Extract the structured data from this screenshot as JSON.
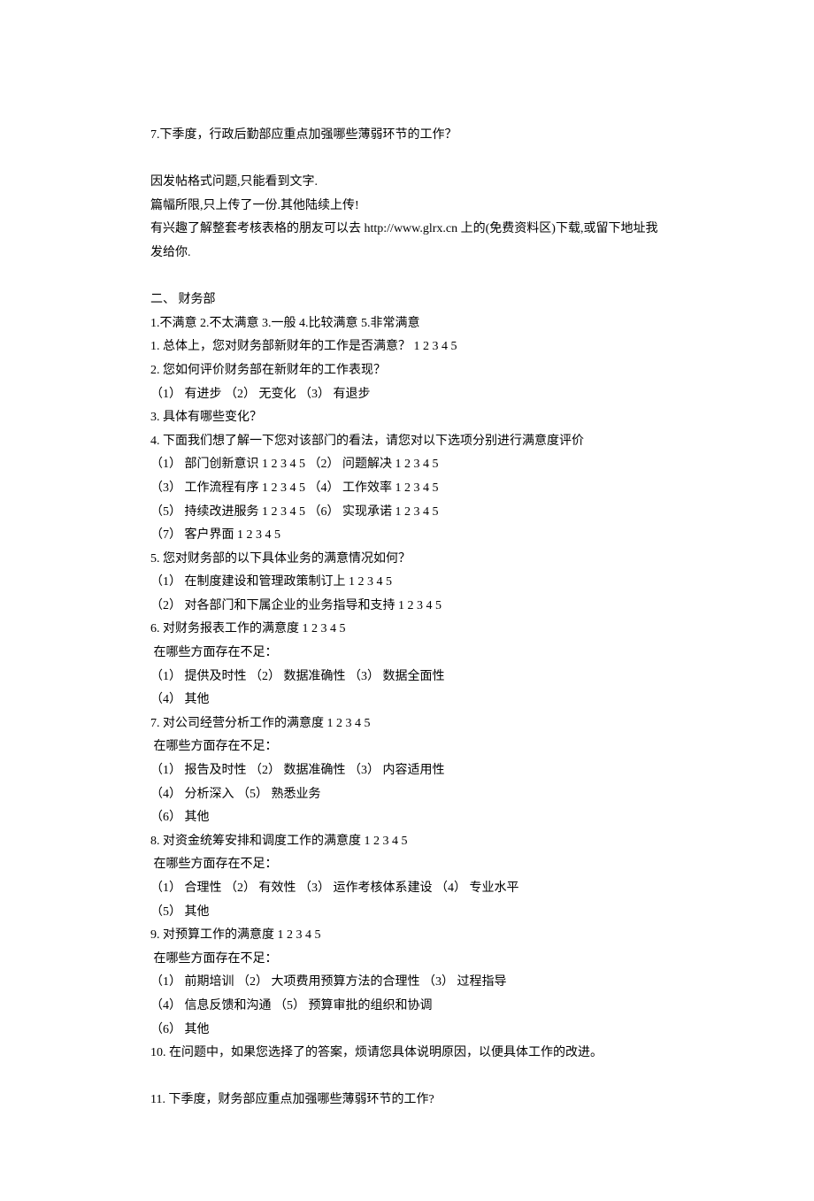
{
  "lines": [
    "7.下季度，行政后勤部应重点加强哪些薄弱环节的工作？",
    "",
    "因发帖格式问题,只能看到文字.",
    "篇幅所限,只上传了一份.其他陆续上传!",
    "有兴趣了解整套考核表格的朋友可以去 http://www.glrx.cn 上的(免费资料区)下载,或留下地址我发给你.",
    "",
    "二、 财务部",
    "1.不满意 2.不太满意 3.一般 4.比较满意 5.非常满意",
    "1. 总体上，您对财务部新财年的工作是否满意？ 1 2 3 4 5",
    "2. 您如何评价财务部在新财年的工作表现？",
    "（1） 有进步 （2） 无变化 （3） 有退步",
    "3. 具体有哪些变化？",
    "4. 下面我们想了解一下您对该部门的看法，请您对以下选项分别进行满意度评价",
    "（1） 部门创新意识 1 2 3 4 5 （2） 问题解决 1 2 3 4 5",
    "（3） 工作流程有序 1 2 3 4 5 （4） 工作效率 1 2 3 4 5",
    "（5） 持续改进服务 1 2 3 4 5 （6） 实现承诺 1 2 3 4 5",
    "（7） 客户界面 1 2 3 4 5",
    "5. 您对财务部的以下具体业务的满意情况如何？",
    "（1） 在制度建设和管理政策制订上 1 2 3 4 5",
    "（2） 对各部门和下属企业的业务指导和支持 1 2 3 4 5",
    "6. 对财务报表工作的满意度 1 2 3 4 5",
    " 在哪些方面存在不足：",
    "（1） 提供及时性 （2） 数据准确性 （3） 数据全面性",
    "（4） 其他",
    "7. 对公司经营分析工作的满意度 1 2 3 4 5",
    " 在哪些方面存在不足：",
    "（1） 报告及时性 （2） 数据准确性 （3） 内容适用性",
    "（4） 分析深入 （5） 熟悉业务",
    "（6） 其他",
    "8. 对资金统筹安排和调度工作的满意度 1 2 3 4 5",
    " 在哪些方面存在不足：",
    "（1） 合理性 （2） 有效性 （3） 运作考核体系建设 （4） 专业水平",
    "（5） 其他",
    "9. 对预算工作的满意度 1 2 3 4 5",
    " 在哪些方面存在不足：",
    "（1） 前期培训 （2） 大项费用预算方法的合理性 （3） 过程指导",
    "（4） 信息反馈和沟通 （5） 预算审批的组织和协调",
    "（6） 其他",
    "10. 在问题中，如果您选择了的答案，烦请您具体说明原因，以便具体工作的改进。",
    "",
    "11. 下季度，财务部应重点加强哪些薄弱环节的工作?"
  ]
}
